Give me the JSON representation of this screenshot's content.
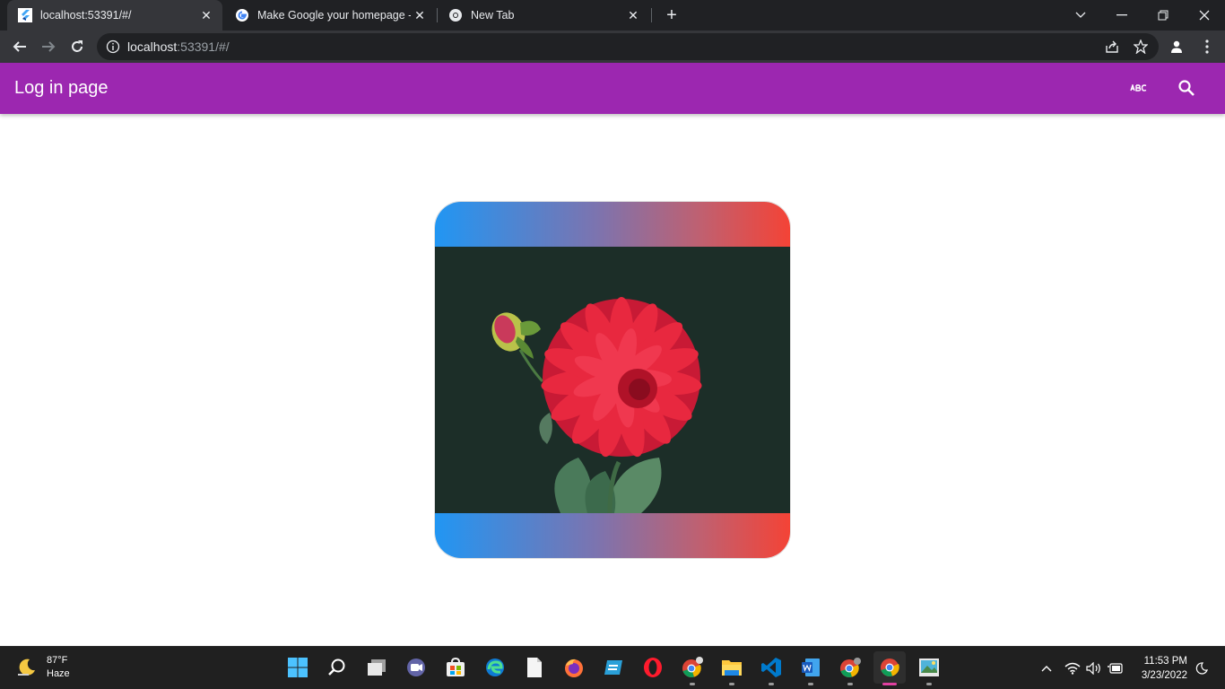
{
  "browser": {
    "tabs": [
      {
        "title": "localhost:53391/#/",
        "active": true,
        "favicon": "flutter-icon"
      },
      {
        "title": "Make Google your homepage - G",
        "active": false,
        "favicon": "google-icon"
      },
      {
        "title": "New Tab",
        "active": false,
        "favicon": "chrome-icon"
      }
    ],
    "url_host": "localhost",
    "url_rest": ":53391/#/"
  },
  "appbar": {
    "title": "Log in page",
    "color": "#9c27b0"
  },
  "card": {
    "gradient_start": "#2196f3",
    "gradient_end": "#f44336",
    "image_subject": "red-dahlia-flower"
  },
  "taskbar": {
    "weather": {
      "temp": "87°F",
      "condition": "Haze"
    },
    "clock": {
      "time": "11:53 PM",
      "date": "3/23/2022"
    }
  }
}
